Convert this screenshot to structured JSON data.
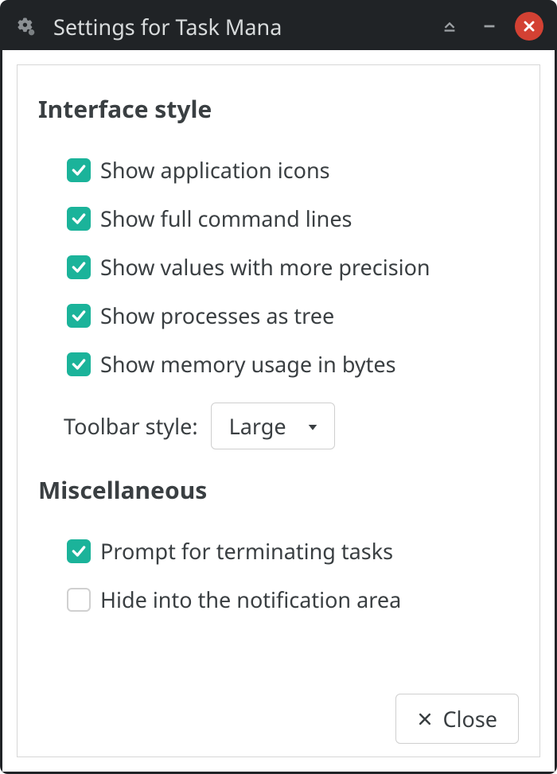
{
  "titlebar": {
    "title": "Settings for Task Mana"
  },
  "sections": {
    "interface": {
      "title": "Interface style",
      "options": {
        "show_icons": {
          "label": "Show application icons",
          "checked": true
        },
        "show_cmd": {
          "label": "Show full command lines",
          "checked": true
        },
        "show_precise": {
          "label": "Show values with more precision",
          "checked": true
        },
        "show_tree": {
          "label": "Show processes as tree",
          "checked": true
        },
        "show_bytes": {
          "label": "Show memory usage in bytes",
          "checked": true
        }
      },
      "toolbar_label": "Toolbar style:",
      "toolbar_value": "Large"
    },
    "misc": {
      "title": "Miscellaneous",
      "options": {
        "prompt_term": {
          "label": "Prompt for terminating tasks",
          "checked": true
        },
        "hide_tray": {
          "label": "Hide into the notification area",
          "checked": false
        }
      }
    }
  },
  "footer": {
    "close_label": "Close"
  }
}
